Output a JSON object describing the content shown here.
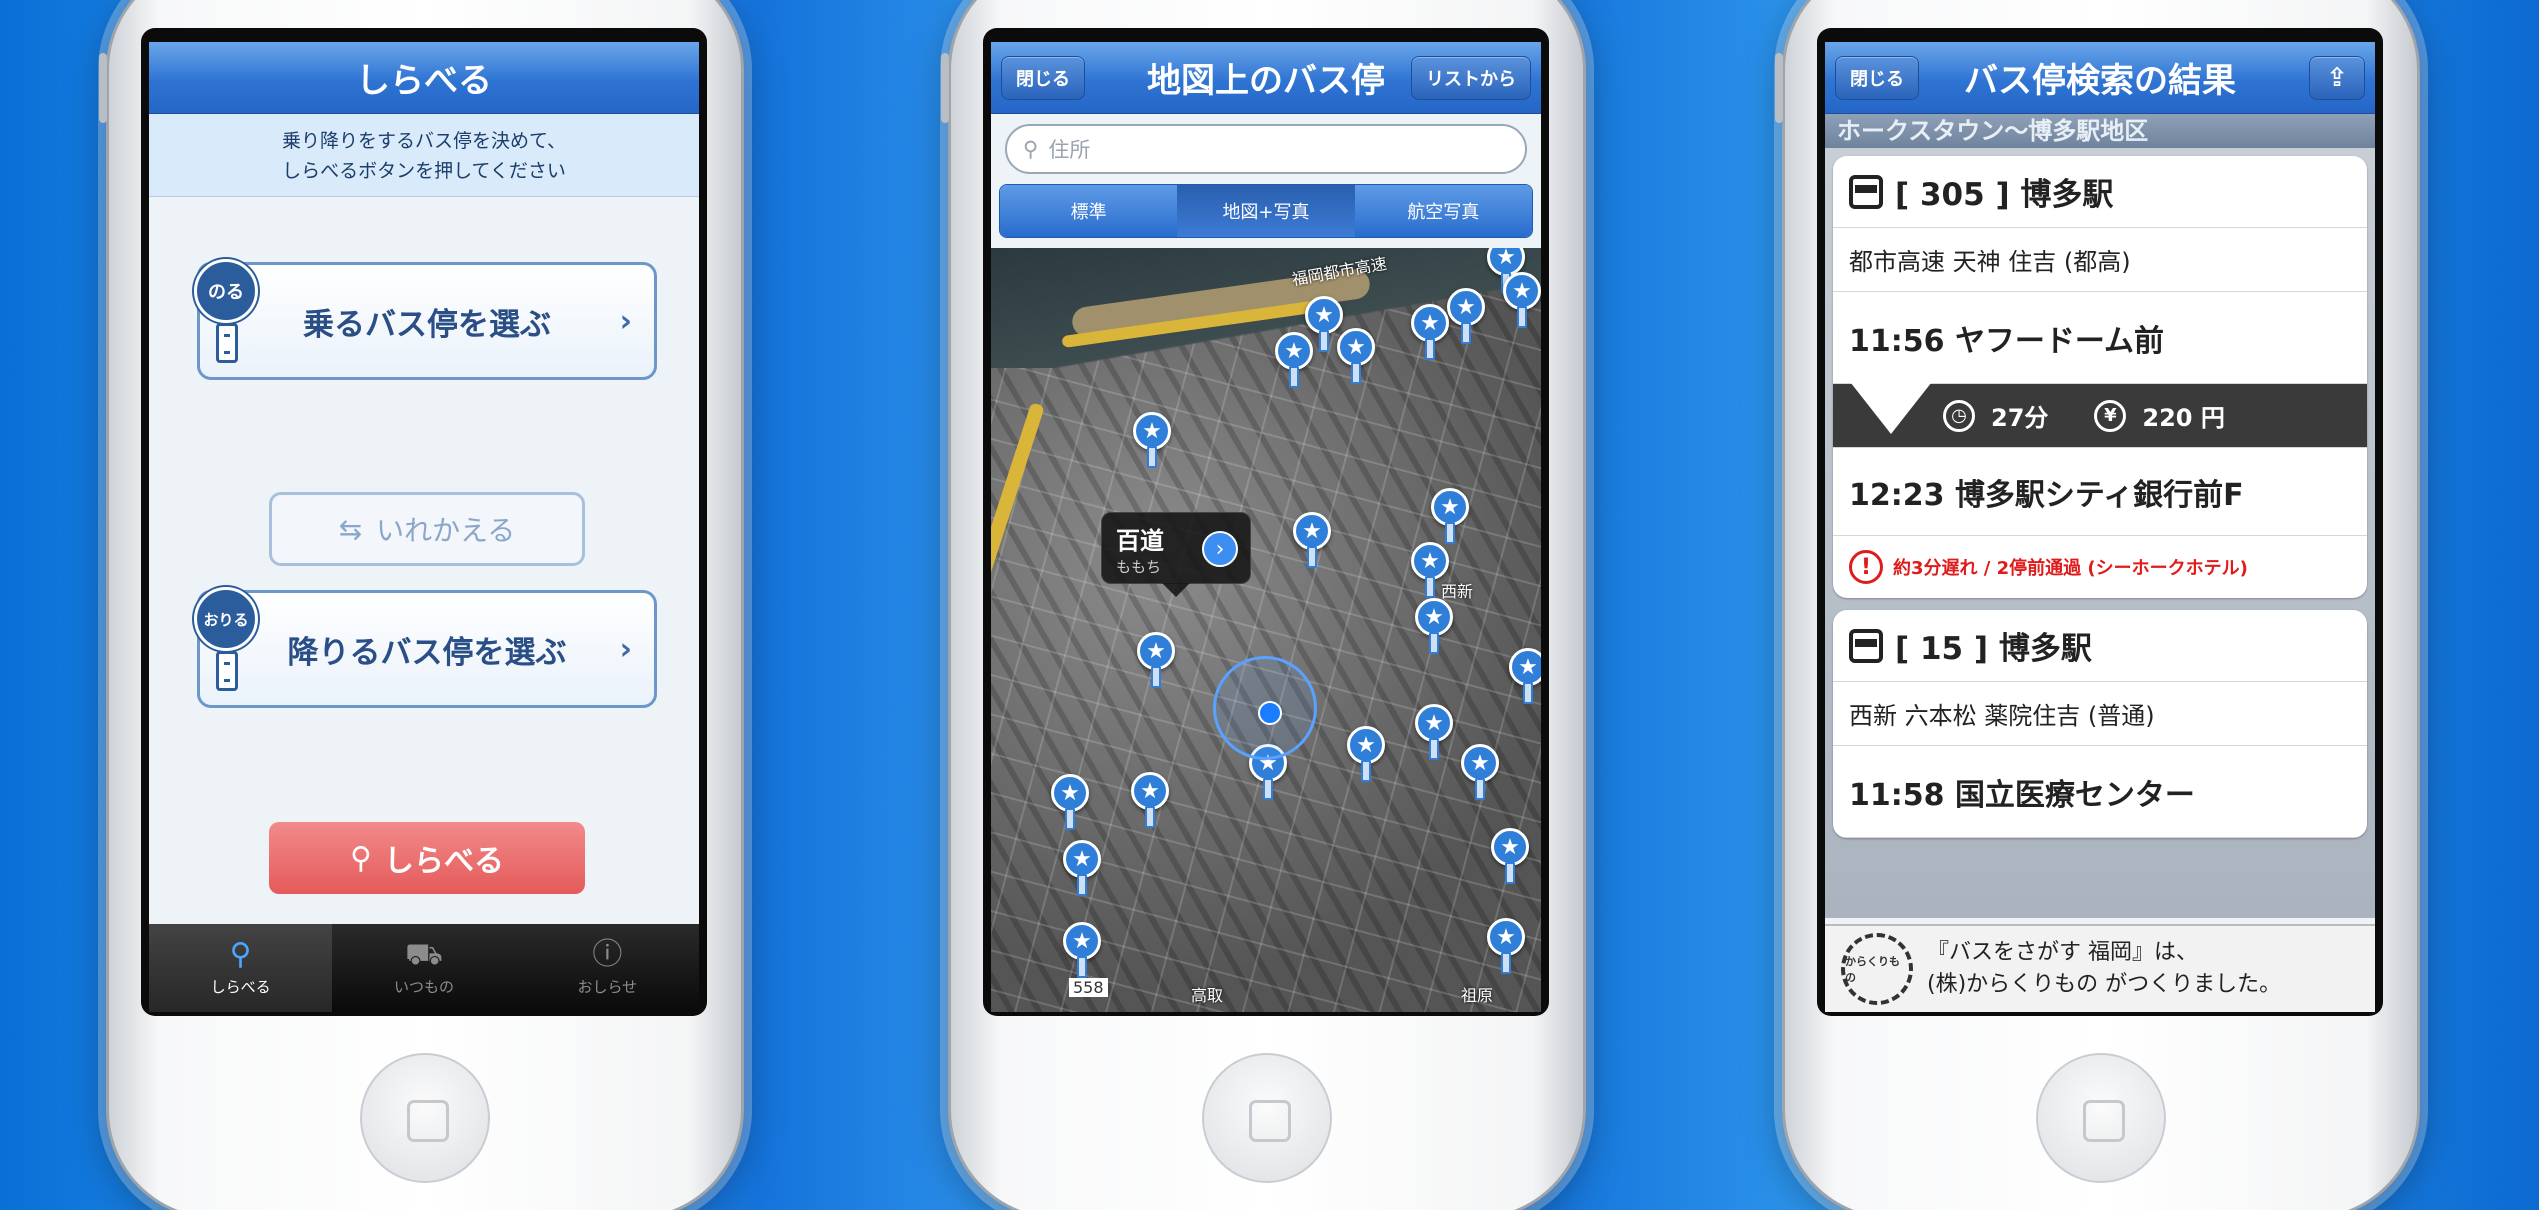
{
  "screen1": {
    "title": "しらべる",
    "instruction": "乗り降りをするバス停を決めて、\nしらべるボタンを押してください",
    "board_badge": "のる",
    "board_button": "乗るバス停を選ぶ",
    "alight_badge": "おりる",
    "alight_button": "降りるバス停を選ぶ",
    "swap_button": "いれかえる",
    "search_button": "しらべる",
    "tabs": [
      {
        "label": "しらべる",
        "icon": "search-icon"
      },
      {
        "label": "いつもの",
        "icon": "bus-stop-icon"
      },
      {
        "label": "おしらせ",
        "icon": "info-icon"
      }
    ]
  },
  "screen2": {
    "close": "閉じる",
    "title": "地図上のバス停",
    "list_button": "リストから",
    "address_placeholder": "住所",
    "segments": [
      "標準",
      "地図+写真",
      "航空写真"
    ],
    "callout_name": "百道",
    "callout_kana": "ももち",
    "map_labels": [
      "西新",
      "高取",
      "祖原",
      "福岡都市高速",
      "558"
    ]
  },
  "screen3": {
    "close": "閉じる",
    "title": "バス停検索の結果",
    "area": "ホークスタウン〜博多駅地区",
    "results": [
      {
        "route": "[ 305 ]  博多駅",
        "via": "都市高速 天神 住吉 (都高)",
        "depart": "11:56  ヤフードーム前",
        "duration": "27分",
        "fare": "220 円",
        "arrive": "12:23  博多駅シティ銀行前F",
        "warning": "約3分遅れ / 2停前通過 (シーホークホテル)"
      },
      {
        "route": "[  15 ]  博多駅",
        "via": "西新 六本松 薬院住吉 (普通)",
        "depart": "11:58  国立医療センター"
      }
    ],
    "credit": "『バスをさがす 福岡』は、\n(株)からくりもの がつくりました。",
    "credit_logo": "からくりもの"
  },
  "colors": {
    "nav_blue": "#2f74d3",
    "search_red": "#e55a5a",
    "warning_red": "#e01b1b"
  }
}
